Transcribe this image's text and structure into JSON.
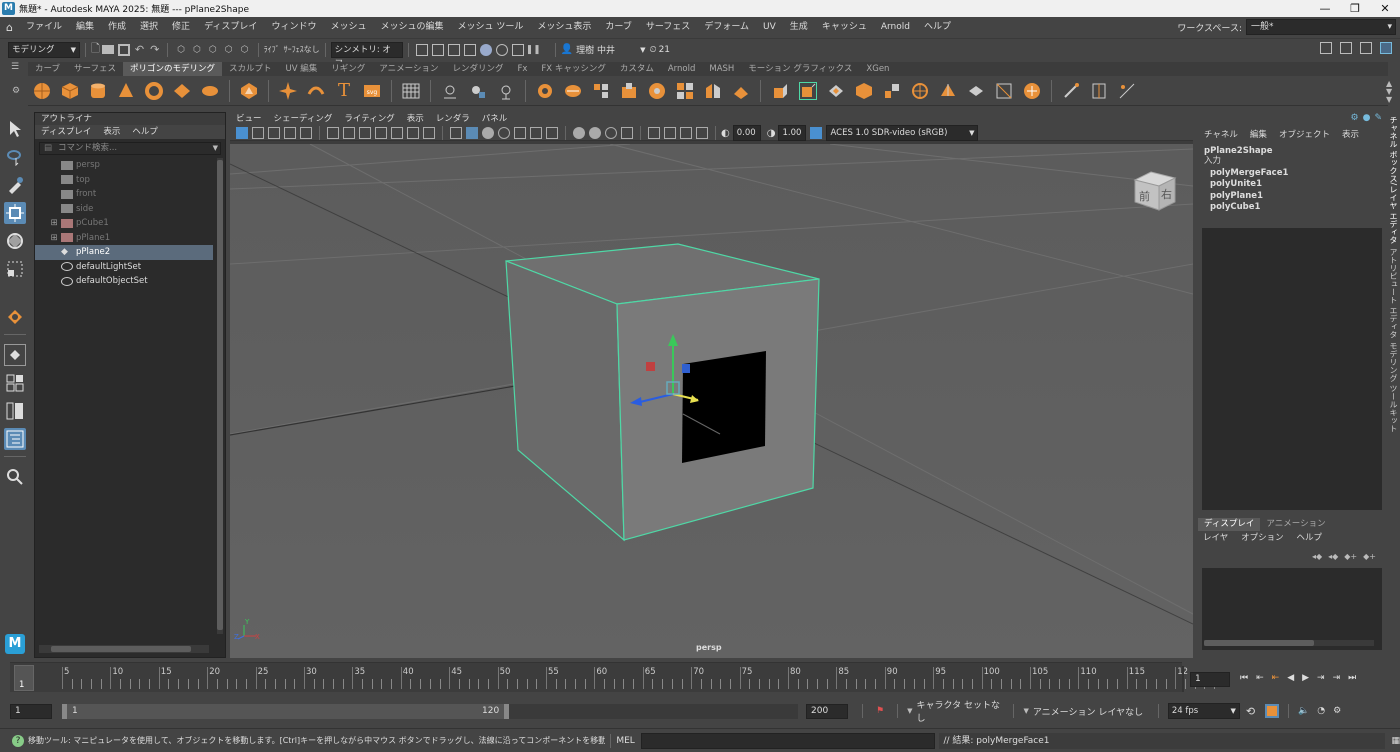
{
  "window": {
    "title": "無題* - Autodesk MAYA 2025: 無題   ---   pPlane2Shape",
    "logo": "M",
    "controls": [
      "—",
      "❐",
      "✕"
    ]
  },
  "menubar": {
    "items": [
      "ファイル",
      "編集",
      "作成",
      "選択",
      "修正",
      "ディスプレイ",
      "ウィンドウ",
      "メッシュ",
      "メッシュの編集",
      "メッシュ ツール",
      "メッシュ表示",
      "カーブ",
      "サーフェス",
      "デフォーム",
      "UV",
      "生成",
      "キャッシュ",
      "Arnold",
      "ヘルプ"
    ],
    "workspace_label": "ワークスペース:",
    "workspace_value": "一般*"
  },
  "statusline": {
    "mode": "モデリング",
    "live_label": "ﾗｲﾌﾞ",
    "live_value": "ｻｰﾌｪｽなし",
    "symmetry": "シンメトリ: オフ",
    "user": "理樹 中井",
    "history_count": "21"
  },
  "shelf": {
    "tabs": [
      "カーブ",
      "サーフェス",
      "ポリゴンのモデリング",
      "スカルプト",
      "UV 編集",
      "リギング",
      "アニメーション",
      "レンダリング",
      "Fx",
      "FX キャッシング",
      "カスタム",
      "Arnold",
      "MASH",
      "モーション グラフィックス",
      "XGen"
    ],
    "active_tab": 2
  },
  "outliner": {
    "title": "アウトライナ",
    "menu": [
      "ディスプレイ",
      "表示",
      "ヘルプ"
    ],
    "search_placeholder": "コマンド検索...",
    "items": [
      {
        "label": "persp",
        "dim": true
      },
      {
        "label": "top",
        "dim": true
      },
      {
        "label": "front",
        "dim": true
      },
      {
        "label": "side",
        "dim": true
      },
      {
        "label": "pCube1",
        "dim": true,
        "expand": "⊞"
      },
      {
        "label": "pPlane1",
        "dim": true,
        "expand": "⊞"
      },
      {
        "label": "pPlane2",
        "selected": true
      },
      {
        "label": "defaultLightSet"
      },
      {
        "label": "defaultObjectSet"
      }
    ]
  },
  "viewport": {
    "menu": [
      "ビュー",
      "シェーディング",
      "ライティング",
      "表示",
      "レンダラ",
      "パネル"
    ],
    "exposure": "0.00",
    "gamma": "1.00",
    "colorspace": "ACES 1.0 SDR-video (sRGB)",
    "camera": "persp",
    "viewcube_front": "前",
    "viewcube_right": "右",
    "axis_y": "Y",
    "axis_x": "X",
    "axis_z": "Z"
  },
  "channelbox": {
    "menu": [
      "チャネル",
      "編集",
      "オブジェクト",
      "表示"
    ],
    "node": "pPlane2Shape",
    "input_label": "入力",
    "inputs": [
      "polyMergeFace1",
      "polyUnite1",
      "polyPlane1",
      "polyCube1"
    ]
  },
  "layers": {
    "tabs": [
      "ディスプレイ",
      "アニメーション"
    ],
    "menu": [
      "レイヤ",
      "オプション",
      "ヘルプ"
    ]
  },
  "side_tabs": [
    "チャネル ボックス/レイヤ エディタ",
    "アトリビュート エディタ",
    "モデリング ツールキット"
  ],
  "timeline": {
    "labels": [
      "1",
      "5",
      "10",
      "15",
      "20",
      "25",
      "30",
      "35",
      "40",
      "45",
      "50",
      "55",
      "60",
      "65",
      "70",
      "75",
      "80",
      "85",
      "90",
      "95",
      "100",
      "105",
      "110",
      "115",
      "12"
    ],
    "current_frame": "1"
  },
  "range": {
    "start": "1",
    "inner_start": "1",
    "inner_end": "120",
    "end": "200",
    "character_set": "キャラクタ セットなし",
    "anim_layer": "アニメーション レイヤなし",
    "fps": "24 fps"
  },
  "commandline": {
    "help": "移動ツール: マニピュレータを使用して、オブジェクトを移動します。[Ctrl]キーを押しながら中マウス ボタンでドラッグし、法線に沿ってコンポーネントを移動します。[Shift]キーを押しながらマニピ",
    "lang": "MEL",
    "result": "// 結果: polyMergeFace1"
  },
  "colors": {
    "accent": "#5b8bb5",
    "shelf_orange": "#e8913a",
    "selection_green": "#4fd8a6"
  }
}
